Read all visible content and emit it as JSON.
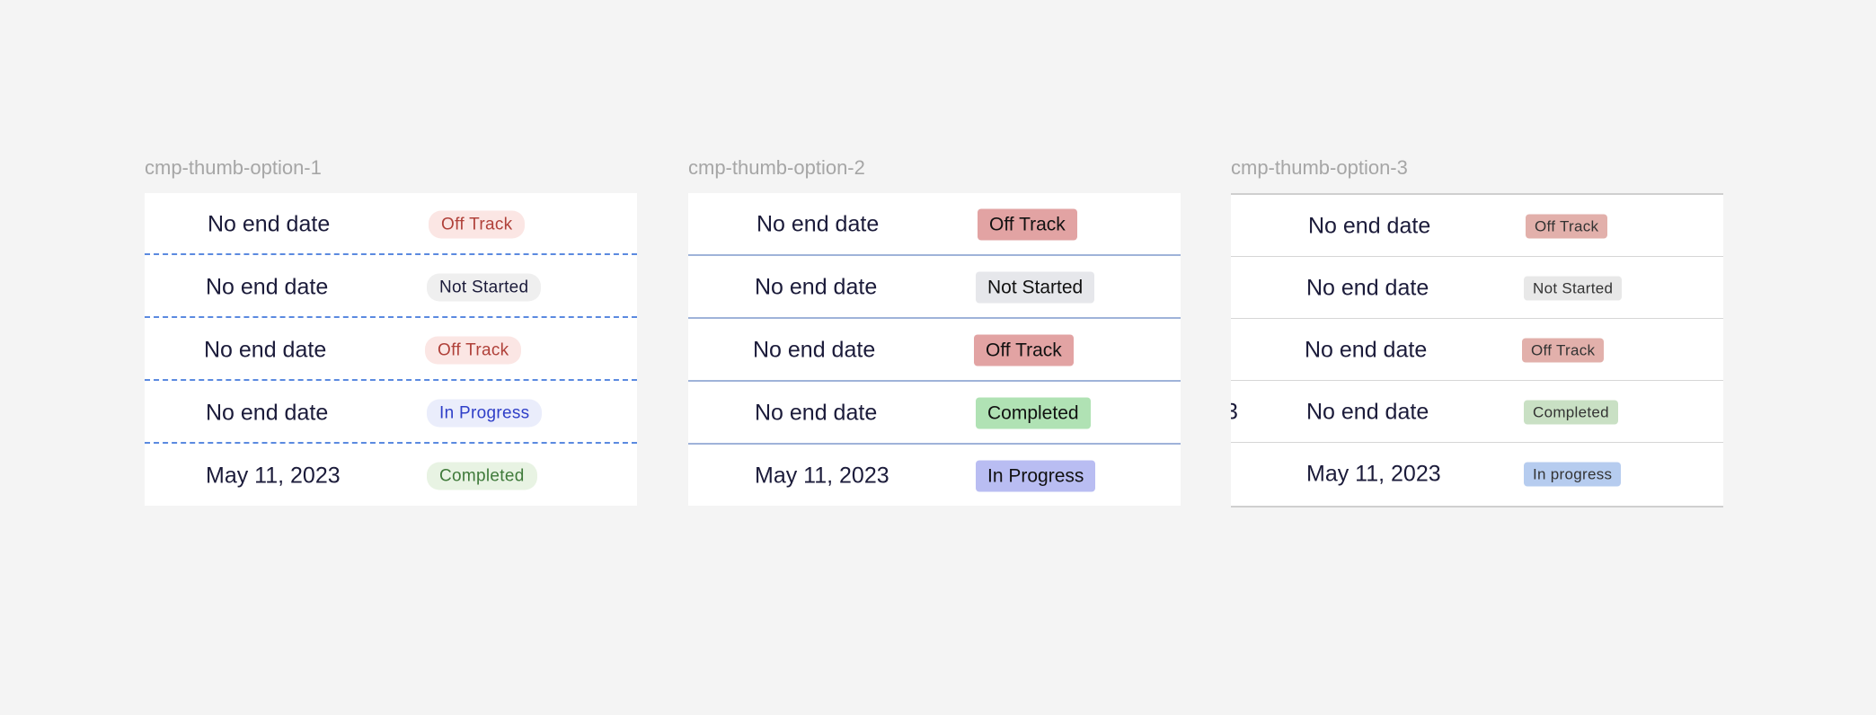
{
  "frames": [
    {
      "label": "cmp-thumb-option-1",
      "rows": [
        {
          "date": "No end date",
          "status": "Off Track"
        },
        {
          "date": "No end date",
          "status": "Not Started"
        },
        {
          "date": "No end date",
          "status": "Off Track"
        },
        {
          "date": "No end date",
          "status": "In Progress"
        },
        {
          "date": "May 11, 2023",
          "status": "Completed"
        }
      ]
    },
    {
      "label": "cmp-thumb-option-2",
      "rows": [
        {
          "date": "No end date",
          "status": "Off Track"
        },
        {
          "date": "No end date",
          "status": "Not Started"
        },
        {
          "date": "No end date",
          "status": "Off Track"
        },
        {
          "date": "No end date",
          "status": "Completed"
        },
        {
          "date": "May 11, 2023",
          "status": "In Progress"
        }
      ]
    },
    {
      "label": "cmp-thumb-option-3",
      "clipped_glyph": "3",
      "rows": [
        {
          "date": "No end date",
          "status": "Off Track"
        },
        {
          "date": "No end date",
          "status": "Not Started"
        },
        {
          "date": "No end date",
          "status": "Off Track"
        },
        {
          "date": "No end date",
          "status": "Completed"
        },
        {
          "date": "May 11, 2023",
          "status": "In progress"
        }
      ]
    }
  ],
  "colors": {
    "page_bg": "#f4f4f4",
    "date_text": "#1b1b3a",
    "option1_divider": "#5b8ae0",
    "option1_off_track": {
      "bg": "#fbe6e4",
      "fg": "#b0413a"
    },
    "option1_not_started": {
      "bg": "#efefef",
      "fg": "#1b1b3a"
    },
    "option1_in_progress": {
      "bg": "#eaedfb",
      "fg": "#2f3fc8"
    },
    "option1_completed": {
      "bg": "#e8f3e3",
      "fg": "#3f7a3a"
    },
    "option2_off_track": "#e2a3a3",
    "option2_not_started": "#e6e7eb",
    "option2_completed": "#b0e2b4",
    "option2_in_progress": "#b9bdf2",
    "option3_off_track": "#e2b0ab",
    "option3_not_started": "#e8e8e8",
    "option3_completed": "#c9e0c4",
    "option3_in_progress": "#b6ccef"
  }
}
